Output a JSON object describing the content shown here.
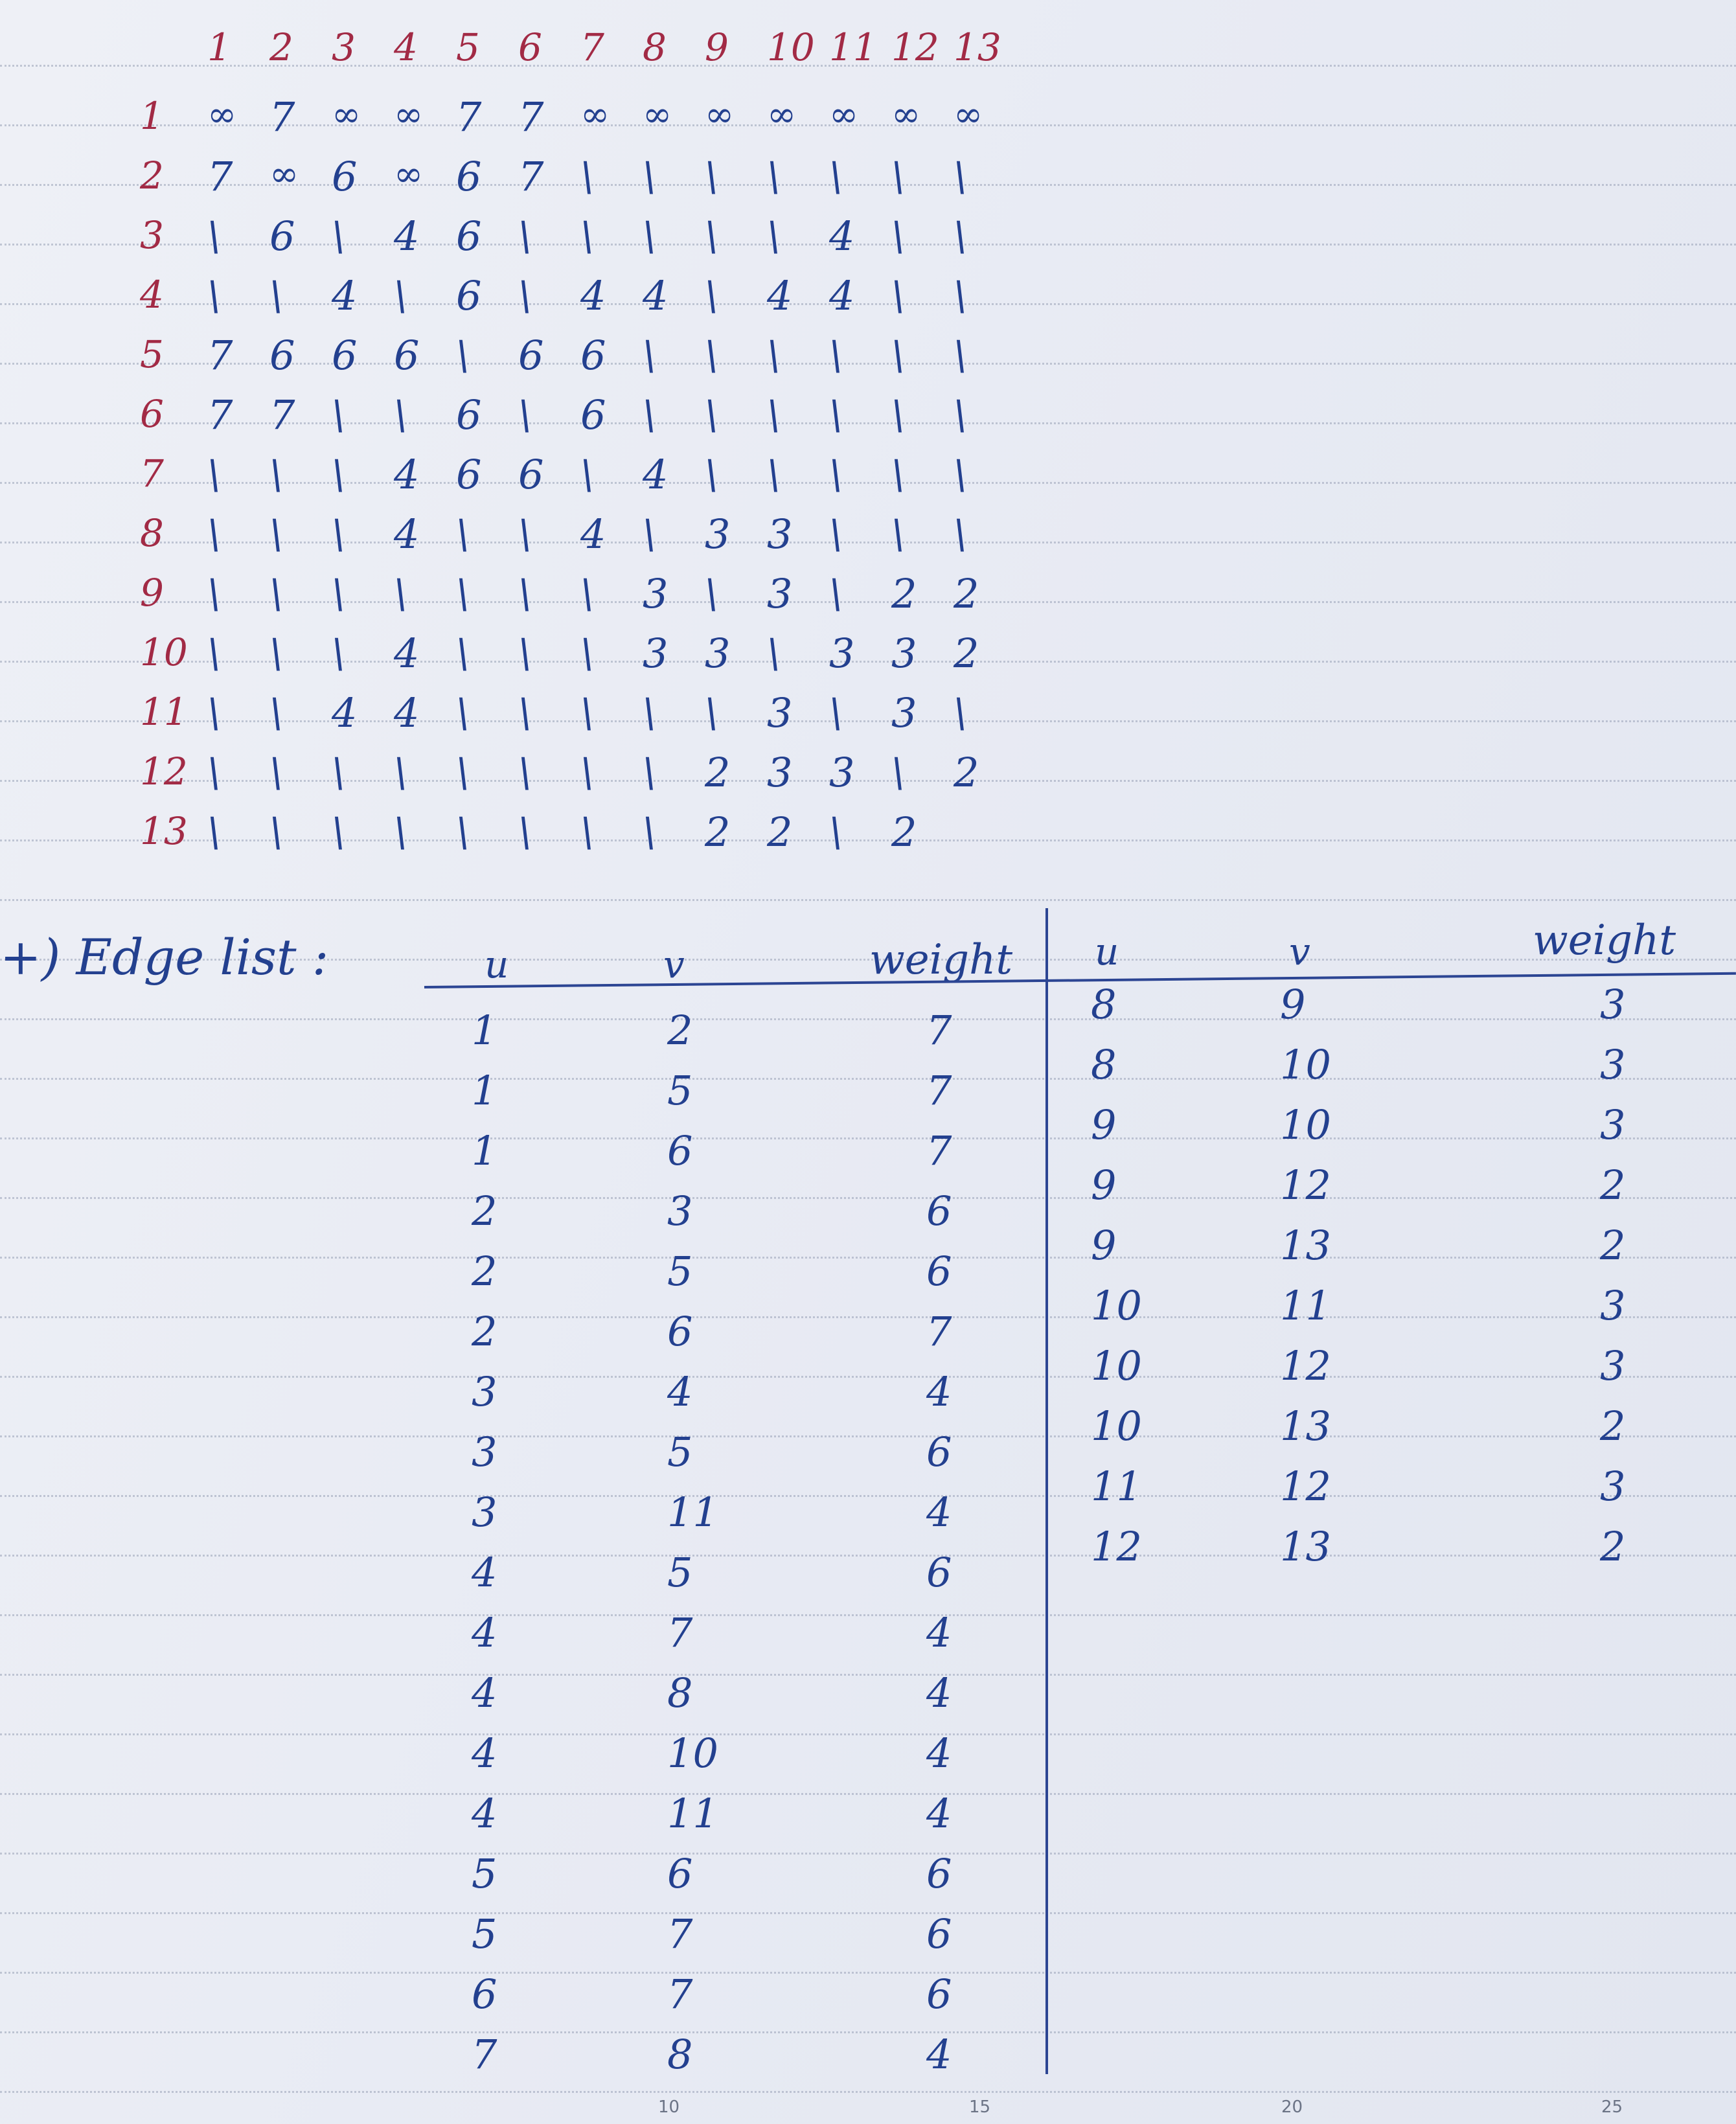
{
  "matrix": {
    "header": [
      "1",
      "2",
      "3",
      "4",
      "5",
      "6",
      "7",
      "8",
      "9",
      "10",
      "11",
      "12",
      "13"
    ],
    "rows": [
      {
        "label": "1",
        "cells": [
          "∞",
          "7",
          "∞",
          "∞",
          "7",
          "7",
          "∞",
          "∞",
          "∞",
          "∞",
          "∞",
          "∞",
          "∞"
        ]
      },
      {
        "label": "2",
        "cells": [
          "7",
          "∞",
          "6",
          "∞",
          "6",
          "7",
          "\\",
          "\\",
          "\\",
          "\\",
          "\\",
          "\\",
          "\\"
        ]
      },
      {
        "label": "3",
        "cells": [
          "\\",
          "6",
          "\\",
          "4",
          "6",
          "\\",
          "\\",
          "\\",
          "\\",
          "\\",
          "4",
          "\\",
          "\\"
        ]
      },
      {
        "label": "4",
        "cells": [
          "\\",
          "\\",
          "4",
          "\\",
          "6",
          "\\",
          "4",
          "4",
          "\\",
          "4",
          "4",
          "\\",
          "\\"
        ]
      },
      {
        "label": "5",
        "cells": [
          "7",
          "6",
          "6",
          "6",
          "\\",
          "6",
          "6",
          "\\",
          "\\",
          "\\",
          "\\",
          "\\",
          "\\"
        ]
      },
      {
        "label": "6",
        "cells": [
          "7",
          "7",
          "\\",
          "\\",
          "6",
          "\\",
          "6",
          "\\",
          "\\",
          "\\",
          "\\",
          "\\",
          "\\"
        ]
      },
      {
        "label": "7",
        "cells": [
          "\\",
          "\\",
          "\\",
          "4",
          "6",
          "6",
          "\\",
          "4",
          "\\",
          "\\",
          "\\",
          "\\",
          "\\"
        ]
      },
      {
        "label": "8",
        "cells": [
          "\\",
          "\\",
          "\\",
          "4",
          "\\",
          "\\",
          "4",
          "\\",
          "3",
          "3",
          "\\",
          "\\",
          "\\"
        ]
      },
      {
        "label": "9",
        "cells": [
          "\\",
          "\\",
          "\\",
          "\\",
          "\\",
          "\\",
          "\\",
          "3",
          "\\",
          "3",
          "\\",
          "2",
          "2"
        ]
      },
      {
        "label": "10",
        "cells": [
          "\\",
          "\\",
          "\\",
          "4",
          "\\",
          "\\",
          "\\",
          "3",
          "3",
          "\\",
          "3",
          "3",
          "2"
        ]
      },
      {
        "label": "11",
        "cells": [
          "\\",
          "\\",
          "4",
          "4",
          "\\",
          "\\",
          "\\",
          "\\",
          "\\",
          "3",
          "\\",
          "3",
          "\\"
        ]
      },
      {
        "label": "12",
        "cells": [
          "\\",
          "\\",
          "\\",
          "\\",
          "\\",
          "\\",
          "\\",
          "\\",
          "2",
          "3",
          "3",
          "\\",
          "2"
        ]
      },
      {
        "label": "13",
        "cells": [
          "\\",
          "\\",
          "\\",
          "\\",
          "\\",
          "\\",
          "\\",
          "\\",
          "2",
          "2",
          "\\",
          "2",
          ""
        ]
      }
    ]
  },
  "edge_list": {
    "title": "+) Edge list :",
    "headers": [
      "u",
      "v",
      "weight"
    ],
    "left": [
      [
        "1",
        "2",
        "7"
      ],
      [
        "1",
        "5",
        "7"
      ],
      [
        "1",
        "6",
        "7"
      ],
      [
        "2",
        "3",
        "6"
      ],
      [
        "2",
        "5",
        "6"
      ],
      [
        "2",
        "6",
        "7"
      ],
      [
        "3",
        "4",
        "4"
      ],
      [
        "3",
        "5",
        "6"
      ],
      [
        "3",
        "11",
        "4"
      ],
      [
        "4",
        "5",
        "6"
      ],
      [
        "4",
        "7",
        "4"
      ],
      [
        "4",
        "8",
        "4"
      ],
      [
        "4",
        "10",
        "4"
      ],
      [
        "4",
        "11",
        "4"
      ],
      [
        "5",
        "6",
        "6"
      ],
      [
        "5",
        "7",
        "6"
      ],
      [
        "6",
        "7",
        "6"
      ],
      [
        "7",
        "8",
        "4"
      ]
    ],
    "right": [
      [
        "8",
        "9",
        "3"
      ],
      [
        "8",
        "10",
        "3"
      ],
      [
        "9",
        "10",
        "3"
      ],
      [
        "9",
        "12",
        "2"
      ],
      [
        "9",
        "13",
        "2"
      ],
      [
        "10",
        "11",
        "3"
      ],
      [
        "10",
        "12",
        "3"
      ],
      [
        "10",
        "13",
        "2"
      ],
      [
        "11",
        "12",
        "3"
      ],
      [
        "12",
        "13",
        "2"
      ]
    ]
  },
  "ruler": [
    "10",
    "15",
    "20",
    "25"
  ],
  "colors": {
    "red_ink": "#a22a45",
    "blue_ink": "#23408f"
  }
}
